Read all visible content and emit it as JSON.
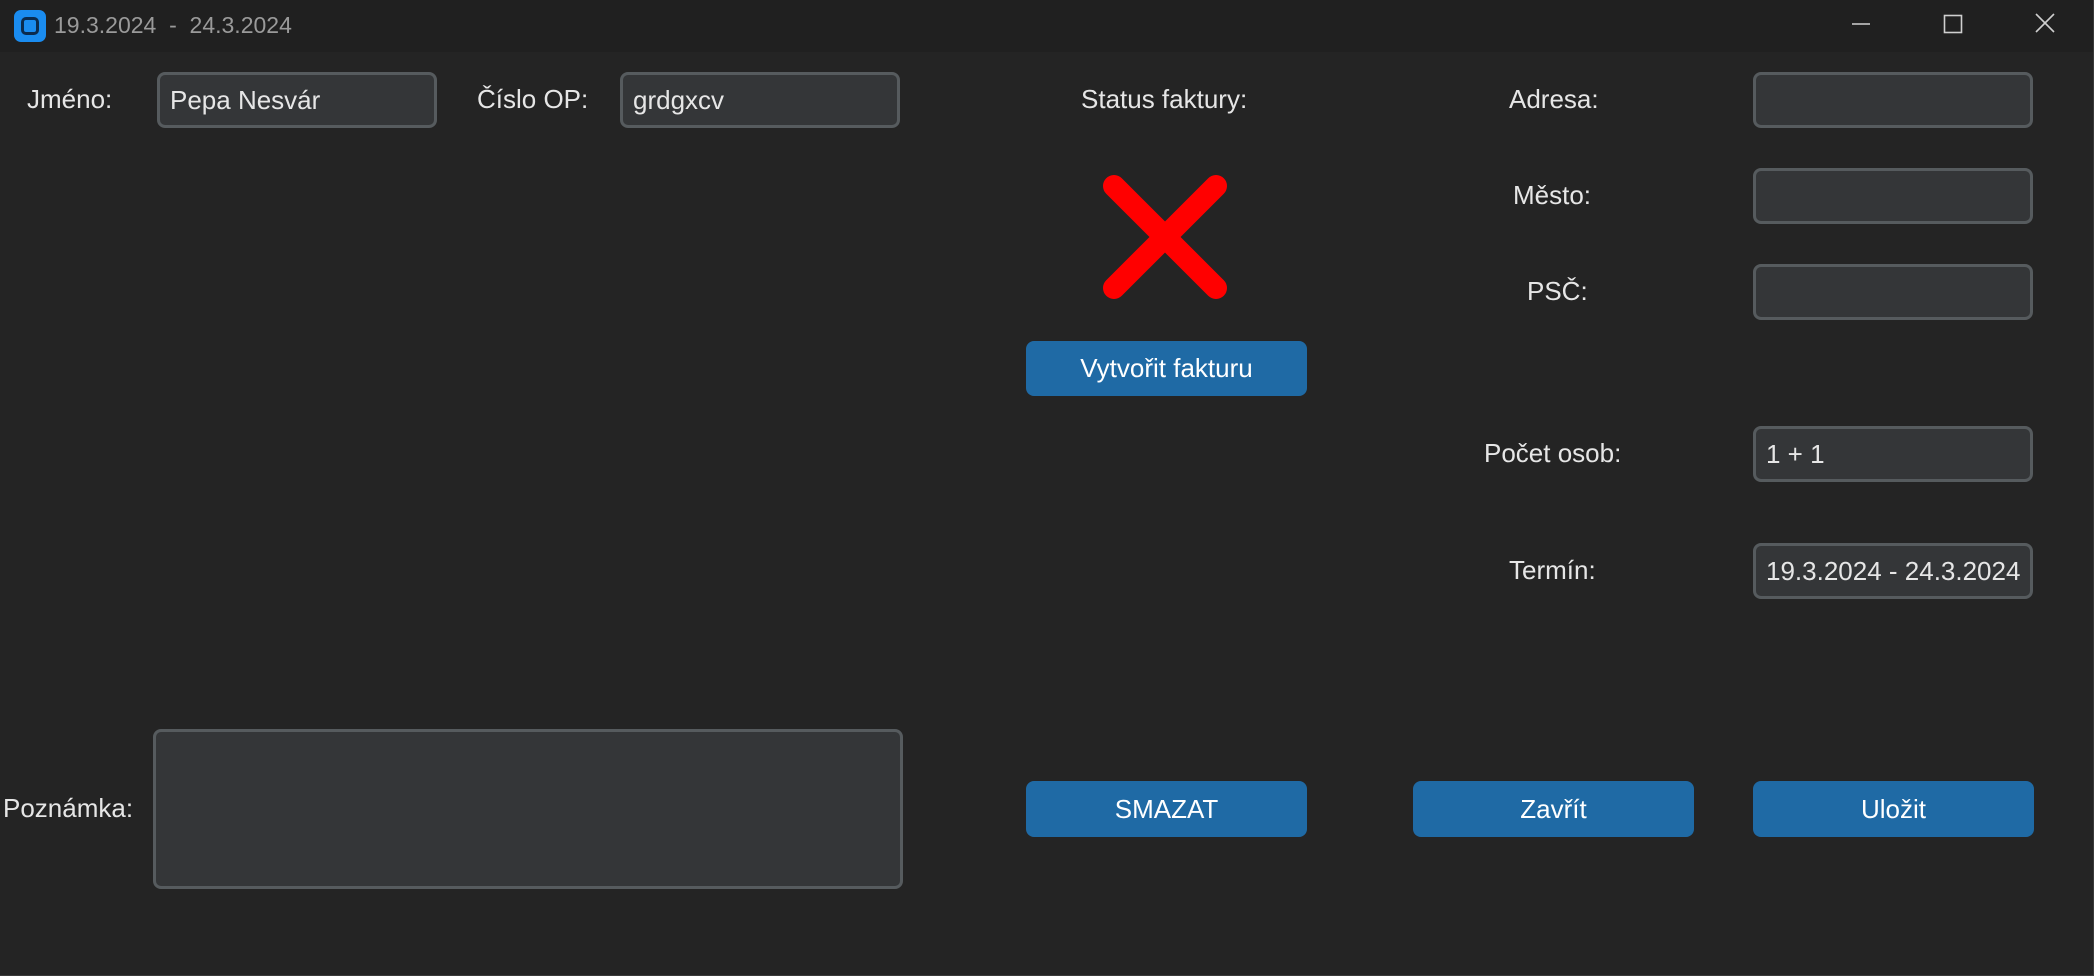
{
  "window": {
    "title": "19.3.2024  -  24.3.2024"
  },
  "left": {
    "name_label": "Jméno:",
    "name_value": "Pepa Nesvár",
    "id_label": "Číslo OP:",
    "id_value": "grdgxcv",
    "note_label": "Poznámka:",
    "note_value": ""
  },
  "center": {
    "status_label": "Status faktury:",
    "status_icon": "red-x-icon",
    "status_color": "#ff0000",
    "create_invoice_label": "Vytvořit fakturu",
    "delete_label": "SMAZAT"
  },
  "right": {
    "address_label": "Adresa:",
    "address_value": "",
    "city_label": "Město:",
    "city_value": "",
    "zip_label": "PSČ:",
    "zip_value": "",
    "persons_label": "Počet osob:",
    "persons_value": "1 + 1",
    "term_label": "Termín:",
    "term_value": "19.3.2024 - 24.3.2024",
    "close_label": "Zavřít",
    "save_label": "Uložit"
  },
  "colors": {
    "background": "#242424",
    "entry_bg": "#343638",
    "entry_border": "#565b5e",
    "button": "#1f6aa5",
    "app_icon": "#1a8cf0"
  }
}
